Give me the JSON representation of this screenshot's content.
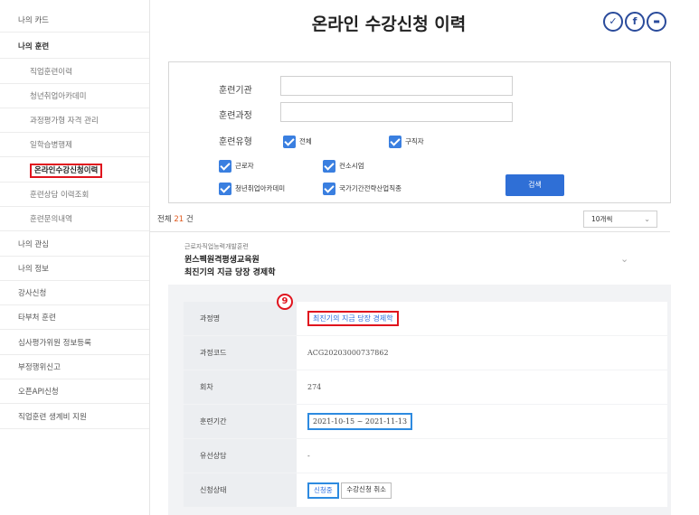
{
  "sidebar": {
    "items": [
      {
        "label": "나의 카드"
      },
      {
        "label": "나의 훈련"
      },
      {
        "label": "직업훈련이력"
      },
      {
        "label": "청년취업아카데미"
      },
      {
        "label": "과정평가형 자격 관리"
      },
      {
        "label": "일학습병행제"
      },
      {
        "label": "온라인수강신청이력"
      },
      {
        "label": "훈련상담 이력조회"
      },
      {
        "label": "훈련문의내역"
      },
      {
        "label": "나의 관심"
      },
      {
        "label": "나의 정보"
      },
      {
        "label": "강사신청"
      },
      {
        "label": "타부처 훈련"
      },
      {
        "label": "심사평가위원 정보등록"
      },
      {
        "label": "부정행위신고"
      },
      {
        "label": "오픈API신청"
      },
      {
        "label": "직업훈련 생계비 지원"
      }
    ]
  },
  "header": {
    "title": "온라인 수강신청 이력",
    "sns": [
      {
        "icon": "twitter-icon",
        "glyph": "✓"
      },
      {
        "icon": "facebook-icon",
        "glyph": "f"
      },
      {
        "icon": "kakao-icon",
        "glyph": "▬"
      }
    ]
  },
  "search": {
    "institution_label": "훈련기관",
    "course_label": "훈련과정",
    "type_label": "훈련유형",
    "institution_value": "",
    "course_value": "",
    "types": [
      {
        "label": "전체",
        "checked": true
      },
      {
        "label": "구직자",
        "checked": true
      },
      {
        "label": "근로자",
        "checked": true
      },
      {
        "label": "컨소시엄",
        "checked": true
      },
      {
        "label": "청년취업아카데미",
        "checked": true
      },
      {
        "label": "국가기간전략산업직종",
        "checked": true
      }
    ],
    "search_button": "검색"
  },
  "results": {
    "total_prefix": "전체",
    "total_count": "21",
    "total_suffix": "건",
    "page_size": "10개씩"
  },
  "item": {
    "category": "근로자직업능력개발훈련",
    "institution": "윈스펙원격평생교육원",
    "course": "최진기의 지금 당장 경제학",
    "step_marker": "9",
    "details": {
      "course_name_label": "과정명",
      "course_name_value": "최진기의 지금 당장 경제학",
      "course_code_label": "과정코드",
      "course_code_value": "ACG20203000737862",
      "round_label": "회차",
      "round_value": "274",
      "period_label": "훈련기간",
      "period_value": "2021-10-15 ~ 2021-11-13",
      "consult_label": "유선상담",
      "consult_value": "-",
      "status_label": "신청상태",
      "status_value": "신청중",
      "cancel_button": "수강신청 취소"
    }
  },
  "colors": {
    "highlight_red": "#e0141e",
    "highlight_blue": "#2d8ae0",
    "checkbox_blue": "#3a7fe0",
    "button_blue": "#2f6fd6",
    "count_orange": "#e05a1e"
  }
}
